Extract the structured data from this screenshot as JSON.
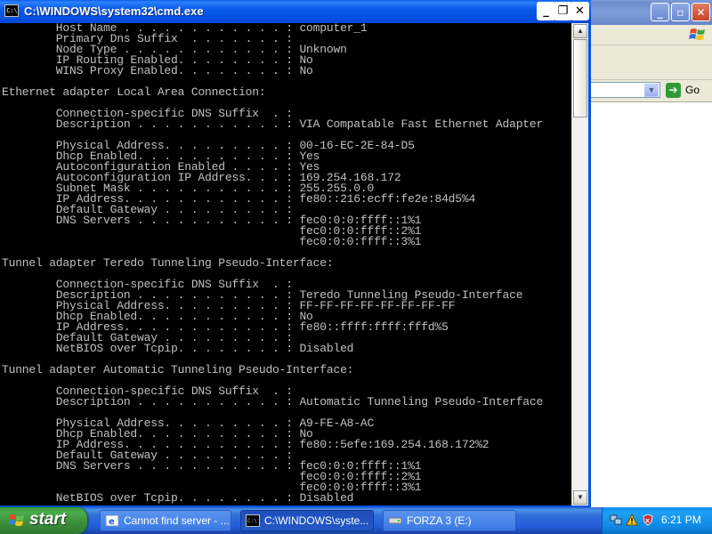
{
  "background_window": {
    "address_dropdown_icon": "chevron-down-icon",
    "go_label": "Go"
  },
  "cmd_window": {
    "title": "C:\\WINDOWS\\system32\\cmd.exe",
    "icon_text": "C:\\",
    "lines": [
      "        Host Name . . . . . . . . . . . . : computer_1",
      "        Primary Dns Suffix  . . . . . . . :",
      "        Node Type . . . . . . . . . . . . : Unknown",
      "        IP Routing Enabled. . . . . . . . : No",
      "        WINS Proxy Enabled. . . . . . . . : No",
      "",
      "Ethernet adapter Local Area Connection:",
      "",
      "        Connection-specific DNS Suffix  . :",
      "        Description . . . . . . . . . . . : VIA Compatable Fast Ethernet Adapter",
      "",
      "        Physical Address. . . . . . . . . : 00-16-EC-2E-84-D5",
      "        Dhcp Enabled. . . . . . . . . . . : Yes",
      "        Autoconfiguration Enabled . . . . : Yes",
      "        Autoconfiguration IP Address. . . : 169.254.168.172",
      "        Subnet Mask . . . . . . . . . . . : 255.255.0.0",
      "        IP Address. . . . . . . . . . . . : fe80::216:ecff:fe2e:84d5%4",
      "        Default Gateway . . . . . . . . . :",
      "        DNS Servers . . . . . . . . . . . : fec0:0:0:ffff::1%1",
      "                                            fec0:0:0:ffff::2%1",
      "                                            fec0:0:0:ffff::3%1",
      "",
      "Tunnel adapter Teredo Tunneling Pseudo-Interface:",
      "",
      "        Connection-specific DNS Suffix  . :",
      "        Description . . . . . . . . . . . : Teredo Tunneling Pseudo-Interface",
      "        Physical Address. . . . . . . . . : FF-FF-FF-FF-FF-FF-FF-FF",
      "        Dhcp Enabled. . . . . . . . . . . : No",
      "        IP Address. . . . . . . . . . . . : fe80::ffff:ffff:fffd%5",
      "        Default Gateway . . . . . . . . . :",
      "        NetBIOS over Tcpip. . . . . . . . : Disabled",
      "",
      "Tunnel adapter Automatic Tunneling Pseudo-Interface:",
      "",
      "        Connection-specific DNS Suffix  . :",
      "        Description . . . . . . . . . . . : Automatic Tunneling Pseudo-Interface",
      "",
      "        Physical Address. . . . . . . . . : A9-FE-A8-AC",
      "        Dhcp Enabled. . . . . . . . . . . : No",
      "        IP Address. . . . . . . . . . . . : fe80::5efe:169.254.168.172%2",
      "        Default Gateway . . . . . . . . . :",
      "        DNS Servers . . . . . . . . . . . : fec0:0:0:ffff::1%1",
      "                                            fec0:0:0:ffff::2%1",
      "                                            fec0:0:0:ffff::3%1",
      "        NetBIOS over Tcpip. . . . . . . . : Disabled"
    ]
  },
  "taskbar": {
    "start_label": "start",
    "items": [
      {
        "label": "Cannot find server - ...",
        "icon": "ie-icon"
      },
      {
        "label": "C:\\WINDOWS\\syste...",
        "icon": "cmd-icon"
      },
      {
        "label": "FORZA 3 (E:)",
        "icon": "drive-icon"
      }
    ],
    "clock": "6:21 PM"
  }
}
